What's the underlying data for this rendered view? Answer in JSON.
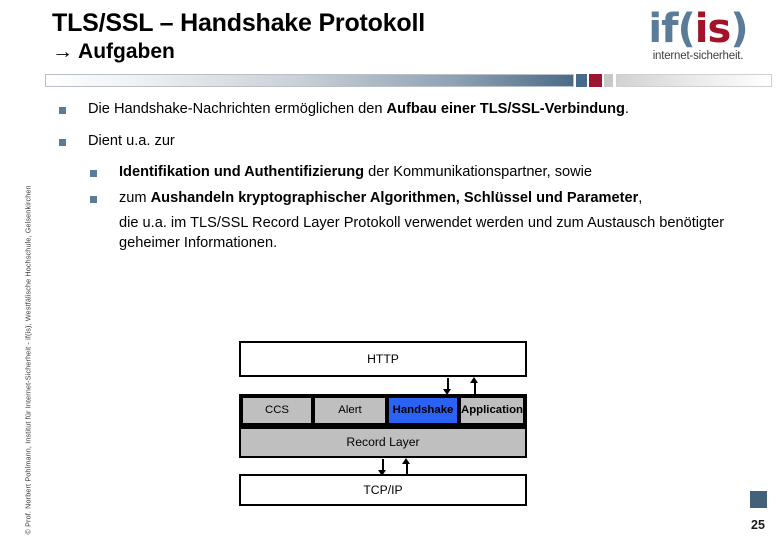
{
  "header": {
    "title_line1": "TLS/SSL – Handshake Protokoll",
    "title_line2": "→ Aufgaben",
    "logo": {
      "part_if": "if",
      "part_paren_open": "(",
      "part_i": "i",
      "part_s": "s",
      "part_paren_close": ")",
      "subtitle": "internet-sicherheit.",
      "blue": "#5b7c99",
      "red": "#a31228"
    },
    "divider": {
      "accent_blue": "#4a6b88",
      "accent_red": "#9c1631",
      "accent_gray": "#c8c8c8"
    }
  },
  "sidebar": {
    "copyright": "© Prof. Norbert Pohlmann, Institut für Internet-Sicherheit - if(is), Westfälische Hochschule, Gelsenkirchen"
  },
  "body": {
    "bullet_color": "#5b7c99",
    "b1": {
      "text_a": "Die Handshake-Nachrichten ermöglichen den ",
      "text_b": "Aufbau einer TLS/SSL-Verbindung",
      "text_c": "."
    },
    "b2": {
      "text": "Dient u.a. zur"
    },
    "sub1": {
      "text_a": "Identifikation und Authentifizierung",
      "text_b": " der Kommunikationspartner, sowie"
    },
    "sub2": {
      "text_a": "zum ",
      "text_b": "Aushandeln kryptographischer Algorithmen, Schlüssel und Parameter",
      "text_c": ","
    },
    "tail": {
      "text": "die u.a. im TLS/SSL Record Layer Protokoll verwendet werden und zum Austausch benötigter geheimer Informationen."
    }
  },
  "diagram": {
    "http": "HTTP",
    "ccs": "CCS",
    "alert": "Alert",
    "handshake": "Handshake",
    "application": "Application",
    "record_layer": "Record Layer",
    "tcpip": "TCP/IP",
    "highlight_color": "#2a62f5",
    "fill_color": "#bfbfbf"
  },
  "footer": {
    "page": "25",
    "square_color": "#456179"
  }
}
